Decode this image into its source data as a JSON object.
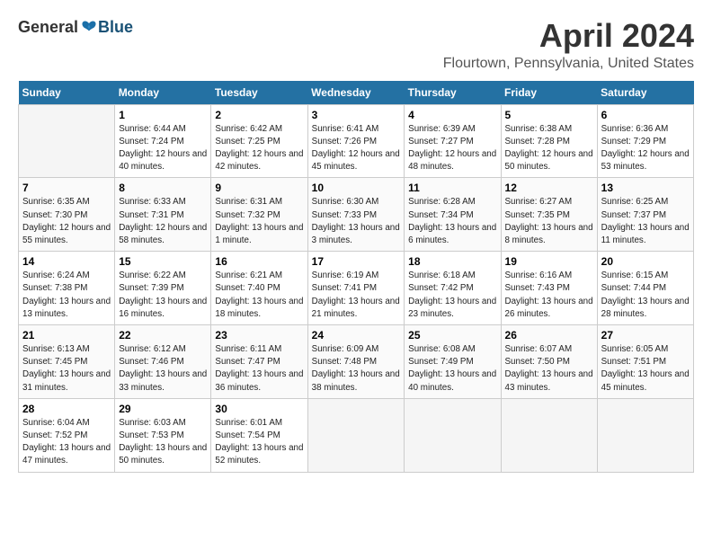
{
  "header": {
    "logo_general": "General",
    "logo_blue": "Blue",
    "month_title": "April 2024",
    "location": "Flourtown, Pennsylvania, United States"
  },
  "days_of_week": [
    "Sunday",
    "Monday",
    "Tuesday",
    "Wednesday",
    "Thursday",
    "Friday",
    "Saturday"
  ],
  "weeks": [
    [
      {
        "day": "",
        "empty": true
      },
      {
        "day": "1",
        "sunrise": "Sunrise: 6:44 AM",
        "sunset": "Sunset: 7:24 PM",
        "daylight": "Daylight: 12 hours and 40 minutes."
      },
      {
        "day": "2",
        "sunrise": "Sunrise: 6:42 AM",
        "sunset": "Sunset: 7:25 PM",
        "daylight": "Daylight: 12 hours and 42 minutes."
      },
      {
        "day": "3",
        "sunrise": "Sunrise: 6:41 AM",
        "sunset": "Sunset: 7:26 PM",
        "daylight": "Daylight: 12 hours and 45 minutes."
      },
      {
        "day": "4",
        "sunrise": "Sunrise: 6:39 AM",
        "sunset": "Sunset: 7:27 PM",
        "daylight": "Daylight: 12 hours and 48 minutes."
      },
      {
        "day": "5",
        "sunrise": "Sunrise: 6:38 AM",
        "sunset": "Sunset: 7:28 PM",
        "daylight": "Daylight: 12 hours and 50 minutes."
      },
      {
        "day": "6",
        "sunrise": "Sunrise: 6:36 AM",
        "sunset": "Sunset: 7:29 PM",
        "daylight": "Daylight: 12 hours and 53 minutes."
      }
    ],
    [
      {
        "day": "7",
        "sunrise": "Sunrise: 6:35 AM",
        "sunset": "Sunset: 7:30 PM",
        "daylight": "Daylight: 12 hours and 55 minutes."
      },
      {
        "day": "8",
        "sunrise": "Sunrise: 6:33 AM",
        "sunset": "Sunset: 7:31 PM",
        "daylight": "Daylight: 12 hours and 58 minutes."
      },
      {
        "day": "9",
        "sunrise": "Sunrise: 6:31 AM",
        "sunset": "Sunset: 7:32 PM",
        "daylight": "Daylight: 13 hours and 1 minute."
      },
      {
        "day": "10",
        "sunrise": "Sunrise: 6:30 AM",
        "sunset": "Sunset: 7:33 PM",
        "daylight": "Daylight: 13 hours and 3 minutes."
      },
      {
        "day": "11",
        "sunrise": "Sunrise: 6:28 AM",
        "sunset": "Sunset: 7:34 PM",
        "daylight": "Daylight: 13 hours and 6 minutes."
      },
      {
        "day": "12",
        "sunrise": "Sunrise: 6:27 AM",
        "sunset": "Sunset: 7:35 PM",
        "daylight": "Daylight: 13 hours and 8 minutes."
      },
      {
        "day": "13",
        "sunrise": "Sunrise: 6:25 AM",
        "sunset": "Sunset: 7:37 PM",
        "daylight": "Daylight: 13 hours and 11 minutes."
      }
    ],
    [
      {
        "day": "14",
        "sunrise": "Sunrise: 6:24 AM",
        "sunset": "Sunset: 7:38 PM",
        "daylight": "Daylight: 13 hours and 13 minutes."
      },
      {
        "day": "15",
        "sunrise": "Sunrise: 6:22 AM",
        "sunset": "Sunset: 7:39 PM",
        "daylight": "Daylight: 13 hours and 16 minutes."
      },
      {
        "day": "16",
        "sunrise": "Sunrise: 6:21 AM",
        "sunset": "Sunset: 7:40 PM",
        "daylight": "Daylight: 13 hours and 18 minutes."
      },
      {
        "day": "17",
        "sunrise": "Sunrise: 6:19 AM",
        "sunset": "Sunset: 7:41 PM",
        "daylight": "Daylight: 13 hours and 21 minutes."
      },
      {
        "day": "18",
        "sunrise": "Sunrise: 6:18 AM",
        "sunset": "Sunset: 7:42 PM",
        "daylight": "Daylight: 13 hours and 23 minutes."
      },
      {
        "day": "19",
        "sunrise": "Sunrise: 6:16 AM",
        "sunset": "Sunset: 7:43 PM",
        "daylight": "Daylight: 13 hours and 26 minutes."
      },
      {
        "day": "20",
        "sunrise": "Sunrise: 6:15 AM",
        "sunset": "Sunset: 7:44 PM",
        "daylight": "Daylight: 13 hours and 28 minutes."
      }
    ],
    [
      {
        "day": "21",
        "sunrise": "Sunrise: 6:13 AM",
        "sunset": "Sunset: 7:45 PM",
        "daylight": "Daylight: 13 hours and 31 minutes."
      },
      {
        "day": "22",
        "sunrise": "Sunrise: 6:12 AM",
        "sunset": "Sunset: 7:46 PM",
        "daylight": "Daylight: 13 hours and 33 minutes."
      },
      {
        "day": "23",
        "sunrise": "Sunrise: 6:11 AM",
        "sunset": "Sunset: 7:47 PM",
        "daylight": "Daylight: 13 hours and 36 minutes."
      },
      {
        "day": "24",
        "sunrise": "Sunrise: 6:09 AM",
        "sunset": "Sunset: 7:48 PM",
        "daylight": "Daylight: 13 hours and 38 minutes."
      },
      {
        "day": "25",
        "sunrise": "Sunrise: 6:08 AM",
        "sunset": "Sunset: 7:49 PM",
        "daylight": "Daylight: 13 hours and 40 minutes."
      },
      {
        "day": "26",
        "sunrise": "Sunrise: 6:07 AM",
        "sunset": "Sunset: 7:50 PM",
        "daylight": "Daylight: 13 hours and 43 minutes."
      },
      {
        "day": "27",
        "sunrise": "Sunrise: 6:05 AM",
        "sunset": "Sunset: 7:51 PM",
        "daylight": "Daylight: 13 hours and 45 minutes."
      }
    ],
    [
      {
        "day": "28",
        "sunrise": "Sunrise: 6:04 AM",
        "sunset": "Sunset: 7:52 PM",
        "daylight": "Daylight: 13 hours and 47 minutes."
      },
      {
        "day": "29",
        "sunrise": "Sunrise: 6:03 AM",
        "sunset": "Sunset: 7:53 PM",
        "daylight": "Daylight: 13 hours and 50 minutes."
      },
      {
        "day": "30",
        "sunrise": "Sunrise: 6:01 AM",
        "sunset": "Sunset: 7:54 PM",
        "daylight": "Daylight: 13 hours and 52 minutes."
      },
      {
        "day": "",
        "empty": true
      },
      {
        "day": "",
        "empty": true
      },
      {
        "day": "",
        "empty": true
      },
      {
        "day": "",
        "empty": true
      }
    ]
  ]
}
